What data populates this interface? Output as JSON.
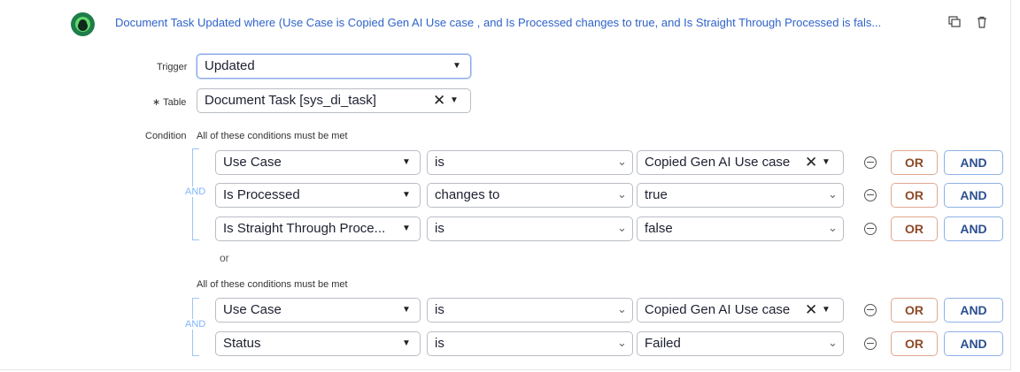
{
  "header": {
    "title": "Document Task Updated where (Use Case is Copied Gen AI Use case , and Is Processed changes to true, and Is Straight Through Processed is fals...",
    "icon": "flow-trigger-icon",
    "copy_icon": "duplicate-icon",
    "delete_icon": "trash-icon",
    "accent_color": "#2f63c9"
  },
  "trigger": {
    "label": "Trigger",
    "value": "Updated"
  },
  "table": {
    "required_mark": "∗",
    "label": "Table",
    "value": "Document Task [sys_di_task]"
  },
  "condition": {
    "label": "Condition",
    "groups": [
      {
        "header": "All of these conditions must be met",
        "join_label": "AND",
        "rows": [
          {
            "field": "Use Case",
            "operator": "is",
            "value": "Copied Gen AI Use case",
            "value_clearable": true
          },
          {
            "field": "Is Processed",
            "operator": "changes to",
            "value": "true",
            "value_clearable": false
          },
          {
            "field": "Is Straight Through Proce...",
            "operator": "is",
            "value": "false",
            "value_clearable": false
          }
        ],
        "separator": "or"
      },
      {
        "header": "All of these conditions must be met",
        "join_label": "AND",
        "rows": [
          {
            "field": "Use Case",
            "operator": "is",
            "value": "Copied Gen AI Use case",
            "value_clearable": true
          },
          {
            "field": "Status",
            "operator": "is",
            "value": "Failed",
            "value_clearable": false
          }
        ]
      }
    ],
    "or_button": "OR",
    "and_button": "AND"
  }
}
